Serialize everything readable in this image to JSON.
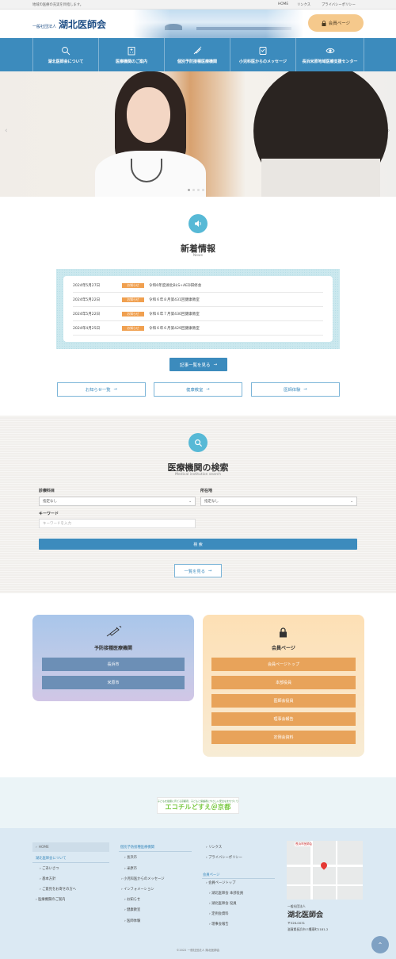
{
  "topbar": {
    "tagline": "地域の医療の充実を目指します。",
    "links": [
      "HOME",
      "リンクス",
      "プライバシーポリシー"
    ]
  },
  "header": {
    "logo_small": "一般社団法人",
    "logo_main": "湖北医師会",
    "member_button": "会員ページ"
  },
  "nav": {
    "items": [
      {
        "label": "湖北医師会について",
        "icon": "magnifier-icon"
      },
      {
        "label": "医療機関のご案内",
        "icon": "hospital-icon"
      },
      {
        "label": "個別予防接種医療機関",
        "icon": "syringe-icon"
      },
      {
        "label": "小児科医からのメッセージ",
        "icon": "shield-icon"
      },
      {
        "label": "長浜米原地域医療支援センター",
        "icon": "eye-icon"
      }
    ]
  },
  "hero": {
    "prev": "‹",
    "next": "›",
    "slides": 4,
    "active": 0
  },
  "news": {
    "title": "新着情報",
    "subtitle": "News",
    "items": [
      {
        "date": "2024年5月27日",
        "badge": "お知らせ",
        "title": "令和6年度湖北BLS+AED研修会"
      },
      {
        "date": "2024年5月22日",
        "badge": "お知らせ",
        "title": "令和６年８月第431回健康教室"
      },
      {
        "date": "2024年5月22日",
        "badge": "お知らせ",
        "title": "令和６年７月第430回健康教室"
      },
      {
        "date": "2024年4月25日",
        "badge": "お知らせ",
        "title": "令和６年６月第429回健康教室"
      }
    ],
    "more_button": "記事一覧を見る",
    "category_buttons": [
      "お知らせ一覧",
      "健康教室",
      "医師体験"
    ]
  },
  "search": {
    "title": "医療機関の検索",
    "subtitle": "Medical institution search",
    "dept_label": "診療科目",
    "dept_value": "指定なし",
    "area_label": "所在地",
    "area_value": "指定なし",
    "keyword_label": "キーワード",
    "keyword_placeholder": "キーワードを入力",
    "search_button": "検 索",
    "list_button": "一覧を見る"
  },
  "vaccine_card": {
    "title": "予防接種医療機関",
    "buttons": [
      "長浜市",
      "米原市"
    ]
  },
  "member_card": {
    "title": "会員ページ",
    "buttons": [
      "会員ページトップ",
      "本部役員",
      "医師会役員",
      "理事会報告",
      "定例会資料"
    ]
  },
  "banner": {
    "caption": "子どもを健康に育てる京都府、子どもと保護者にやさしい安全なまちづくり",
    "name": "エコチルどすえ＠京都"
  },
  "footer": {
    "col1": {
      "home": "HOME",
      "about": "湖北医師会について",
      "about_items": [
        "ごあいさつ",
        "基本方針",
        "ご意見をお寄せの方へ"
      ],
      "institutions": "医療機関のご案内"
    },
    "col2": {
      "vaccine": "個別予防接種医療機関",
      "vaccine_items": [
        "長浜市",
        "米原市"
      ],
      "message": "小児科医からのメッセージ",
      "information": "インフォメーション",
      "info_items": [
        "お知らせ",
        "健康教室",
        "医師体験"
      ]
    },
    "col3": {
      "links": "リンクス",
      "privacy": "プライバシーポリシー",
      "member": "会員ページ",
      "member_top": "会員ページトップ",
      "member_items": [
        "湖北医師会 本部役員",
        "湖北医師会 役員",
        "定例会資料",
        "理事会報告"
      ]
    },
    "address": {
      "small": "一般社団法人",
      "name": "湖北医師会",
      "postal": "〒526-0031",
      "street": "滋賀県長浜市八幡東町1181-2"
    },
    "map_label": "長浜市医師会",
    "copyright": "©2022 一般社団法人 湖北医師会"
  },
  "colors": {
    "primary": "#3c8bbd",
    "accent_orange": "#e8a35a",
    "news_badge": "#f0a050",
    "member_button": "#f5c98c"
  }
}
